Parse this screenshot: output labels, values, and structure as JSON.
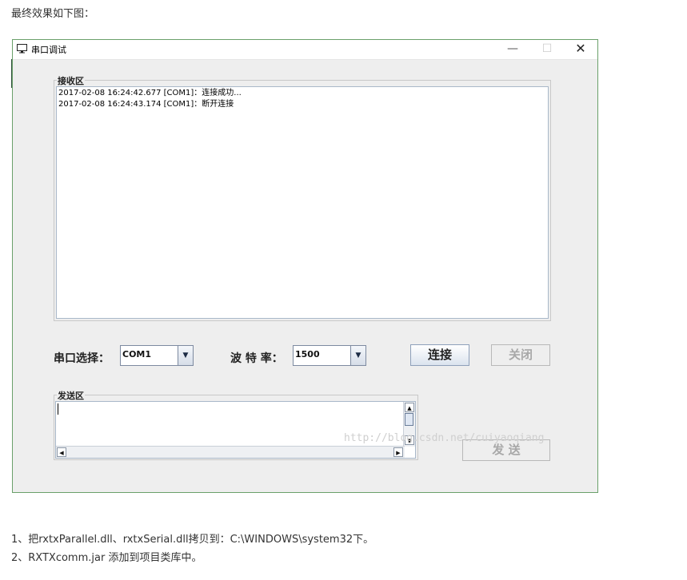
{
  "intro": "最终效果如下图：",
  "window": {
    "title": "串口调试",
    "icons": {
      "app": "monitor-icon",
      "minimize": "minimize-icon",
      "maximize": "maximize-icon",
      "close": "close-icon"
    },
    "min_glyph": "—",
    "max_glyph": "☐",
    "close_glyph": "✕"
  },
  "receive": {
    "legend": "接收区",
    "lines": [
      "2017-02-08 16:24:42.677 [COM1]：连接成功...",
      "2017-02-08 16:24:43.174 [COM1]：断开连接"
    ]
  },
  "controls": {
    "port_label": "串口选择：",
    "port_value": "COM1",
    "baud_label": "波 特 率：",
    "baud_value": "1500",
    "connect_label": "连接",
    "close_label": "关闭"
  },
  "send": {
    "legend": "发送区",
    "button_label": "发 送"
  },
  "watermark": "http://blog.csdn.net/cuiyaoqiang",
  "steps": [
    "1、把rxtxParallel.dll、rxtxSerial.dll拷贝到：C:\\WINDOWS\\system32下。",
    "2、RXTXcomm.jar 添加到项目类库中。"
  ]
}
